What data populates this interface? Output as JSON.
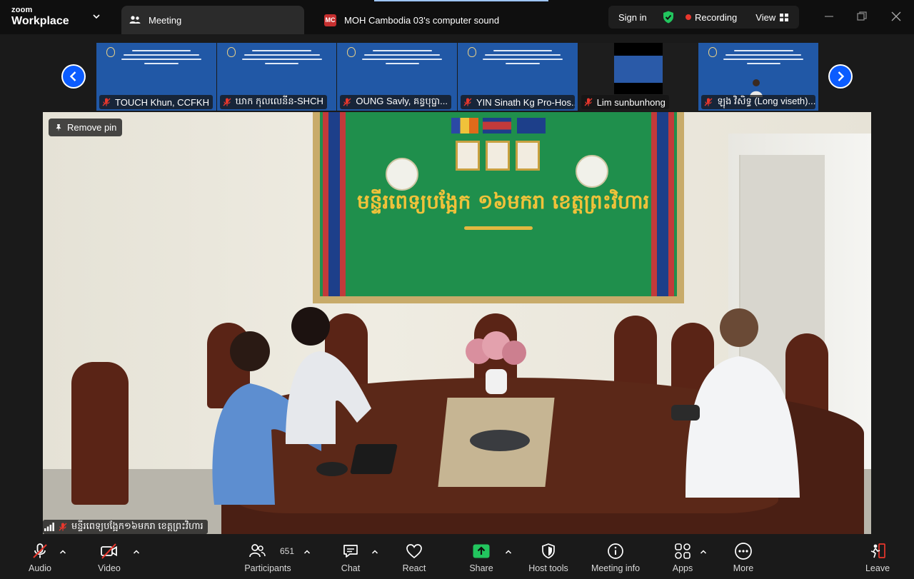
{
  "app": {
    "brand_top": "zoom",
    "brand_bottom": "Workplace"
  },
  "tabs": [
    {
      "label": "Meeting"
    },
    {
      "badge": "MC",
      "label": "MOH Cambodia 03's computer sound"
    }
  ],
  "titlebar": {
    "signin_label": "Sign in",
    "recording_label": "Recording",
    "view_label": "View"
  },
  "thumbnails": [
    {
      "name": "TOUCH Khun, CCFKH",
      "muted": true
    },
    {
      "name": "ឃាក កុលលេនីន-SHCH",
      "muted": true
    },
    {
      "name": "OUNG Savly, គន្ធបុប្ផា...",
      "muted": true
    },
    {
      "name": "YIN Sinath Kg Pro-Hos...",
      "muted": true
    },
    {
      "name": "Lim sunbunhong",
      "muted": true
    },
    {
      "name": "ឡុង វិសិទ្ធ (Long viseth)...",
      "muted": true
    }
  ],
  "main_video": {
    "remove_pin_label": "Remove pin",
    "participant_label": "មន្ទីរពេទ្យបង្អែក១៦មករា ខេត្តព្រះវិហារ",
    "banner_text": "មន្ទីរពេទ្យបង្អែក ១៦មករា ខេត្តព្រះវិហារ"
  },
  "toolbar": {
    "audio": "Audio",
    "video": "Video",
    "participants": "Participants",
    "participants_count": "651",
    "chat": "Chat",
    "react": "React",
    "share": "Share",
    "host_tools": "Host tools",
    "meeting_info": "Meeting info",
    "apps": "Apps",
    "more": "More",
    "leave": "Leave"
  },
  "colors": {
    "background": "#1a1a1a",
    "titlebar": "#0f0f0f",
    "recording_dot": "#e8372d",
    "muted_red": "#e8372d",
    "share_green": "#22c55e",
    "nav_blue": "#0b5cff",
    "slide_blue": "#2158a6"
  }
}
